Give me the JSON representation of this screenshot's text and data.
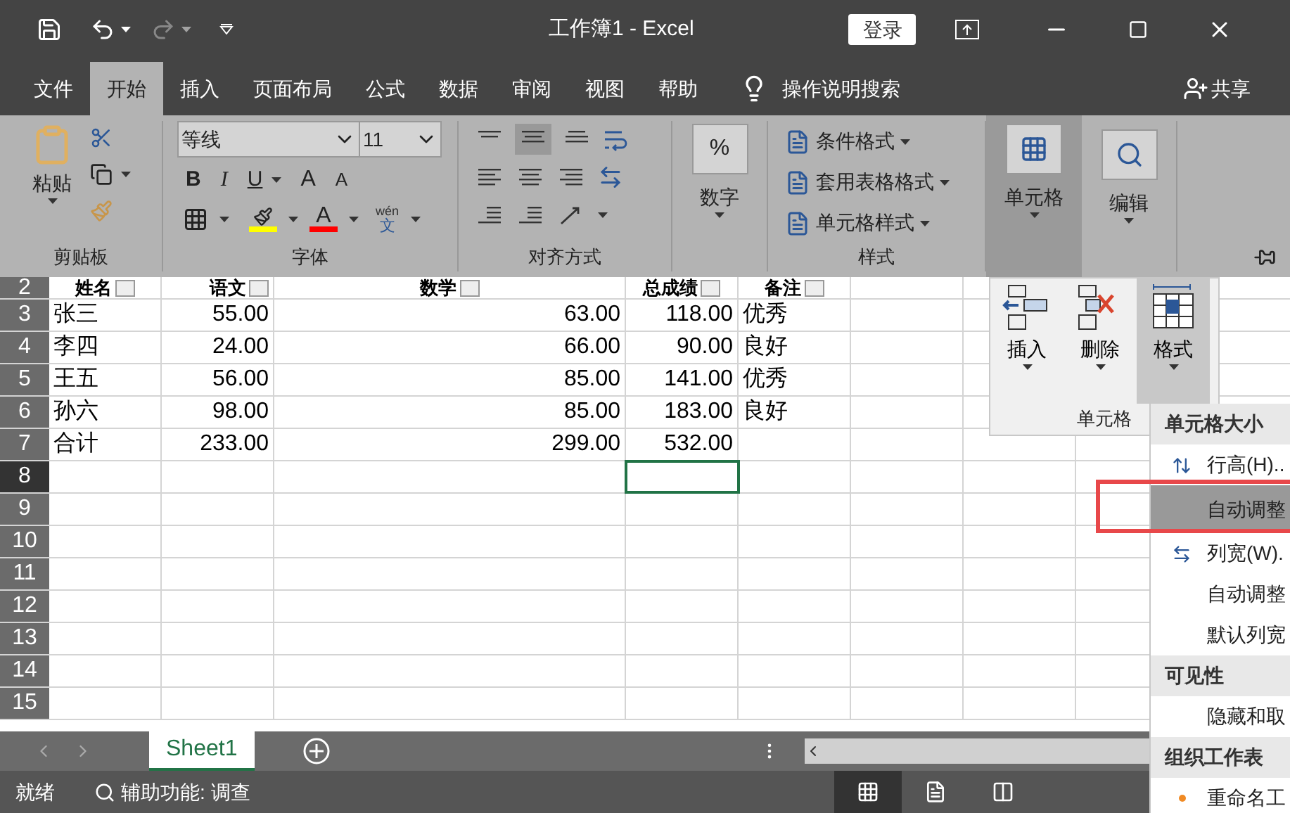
{
  "title_bar": {
    "title": "工作簿1 - Excel",
    "signin": "登录"
  },
  "menu_tabs": [
    {
      "label": "文件",
      "selected": false
    },
    {
      "label": "开始",
      "selected": true
    },
    {
      "label": "插入",
      "selected": false
    },
    {
      "label": "页面布局",
      "selected": false
    },
    {
      "label": "公式",
      "selected": false
    },
    {
      "label": "数据",
      "selected": false
    },
    {
      "label": "审阅",
      "selected": false
    },
    {
      "label": "视图",
      "selected": false
    },
    {
      "label": "帮助",
      "selected": false
    }
  ],
  "tell_me": "操作说明搜索",
  "share": "共享",
  "ribbon": {
    "clipboard": {
      "paste": "粘贴",
      "label": "剪贴板"
    },
    "font": {
      "name": "等线",
      "size": "11",
      "bold": "B",
      "italic": "I",
      "underline": "U",
      "grow": "A",
      "shrink": "A",
      "color_letter": "A",
      "phonetic_top": "wén",
      "phonetic_bottom": "文",
      "label": "字体"
    },
    "alignment": {
      "label": "对齐方式"
    },
    "number": {
      "symbol": "%",
      "label": "数字"
    },
    "styles": {
      "items": [
        "条件格式",
        "套用表格格式",
        "单元格样式"
      ],
      "label": "样式"
    },
    "cells": {
      "label": "单元格",
      "pressed": true
    },
    "editing": {
      "label": "编辑"
    }
  },
  "sheet": {
    "header": {
      "number": "2",
      "cells": [
        "姓名",
        "语文",
        "数学",
        "总成绩",
        "备注"
      ]
    },
    "rows": [
      {
        "number": "3",
        "selected": false,
        "cells": [
          "张三",
          "55.00",
          "63.00",
          "118.00",
          "优秀"
        ]
      },
      {
        "number": "4",
        "selected": false,
        "cells": [
          "李四",
          "24.00",
          "66.00",
          "90.00",
          "良好"
        ]
      },
      {
        "number": "5",
        "selected": false,
        "cells": [
          "王五",
          "56.00",
          "85.00",
          "141.00",
          "优秀"
        ]
      },
      {
        "number": "6",
        "selected": false,
        "cells": [
          "孙六",
          "98.00",
          "85.00",
          "183.00",
          "良好"
        ]
      },
      {
        "number": "7",
        "selected": false,
        "cells": [
          "合计",
          "233.00",
          "299.00",
          "532.00"
        ]
      },
      {
        "number": "8",
        "selected": true
      },
      {
        "number": "9",
        "selected": false
      },
      {
        "number": "10",
        "selected": false
      },
      {
        "number": "11",
        "selected": false
      },
      {
        "number": "12",
        "selected": false
      },
      {
        "number": "13",
        "selected": false
      },
      {
        "number": "14",
        "selected": false
      },
      {
        "number": "15",
        "selected": false
      }
    ]
  },
  "cells_dropdown": {
    "buttons": [
      {
        "label": "插入",
        "kind": "insert",
        "selected": false
      },
      {
        "label": "删除",
        "kind": "delete",
        "selected": false
      },
      {
        "label": "格式",
        "kind": "format",
        "selected": true
      }
    ],
    "label": "单元格"
  },
  "format_menu": [
    {
      "kind": "header",
      "label": "单元格大小"
    },
    {
      "kind": "row-height",
      "label": "行高(H)..",
      "selected": false
    },
    {
      "kind": "item",
      "label": "自动调整",
      "selected": true
    },
    {
      "kind": "column-width",
      "label": "列宽(W).",
      "selected": false
    },
    {
      "kind": "item",
      "label": "自动调整",
      "selected": false
    },
    {
      "kind": "item",
      "label": "默认列宽",
      "selected": false
    },
    {
      "kind": "header",
      "label": "可见性"
    },
    {
      "kind": "item",
      "label": "隐藏和取",
      "selected": false
    },
    {
      "kind": "header",
      "label": "组织工作表"
    },
    {
      "kind": "bulleted",
      "label": "重命名工",
      "selected": false
    }
  ],
  "sheet_tabs": [
    {
      "label": "Sheet1",
      "selected": true
    }
  ],
  "status_bar": {
    "ready": "就绪",
    "accessibility": "辅助功能: 调查",
    "views": [
      {
        "kind": "normal",
        "selected": true
      },
      {
        "kind": "page-layout",
        "selected": false
      },
      {
        "kind": "page-break",
        "selected": false
      }
    ]
  }
}
